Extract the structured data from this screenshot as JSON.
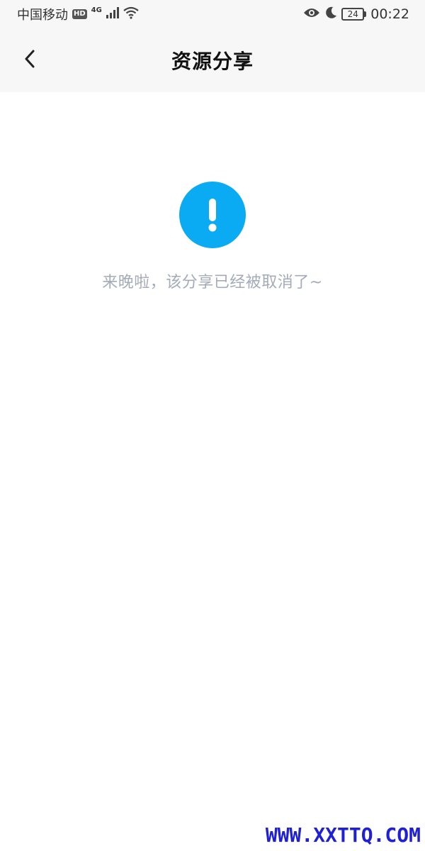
{
  "status_bar": {
    "carrier": "中国移动",
    "hd": "HD",
    "network": "4G",
    "battery": "24",
    "time": "00:22",
    "icons": [
      "signal-icon",
      "wifi-icon",
      "eye-icon",
      "moon-icon",
      "battery-icon"
    ]
  },
  "header": {
    "title": "资源分享",
    "back_icon": "chevron-left-icon"
  },
  "empty_state": {
    "icon": "alert-icon",
    "icon_color": "#0aabf2",
    "message": "来晚啦，该分享已经被取消了~"
  },
  "watermark": {
    "text": "WWW.XXTTQ.COM",
    "color": "#1f1fd6"
  }
}
